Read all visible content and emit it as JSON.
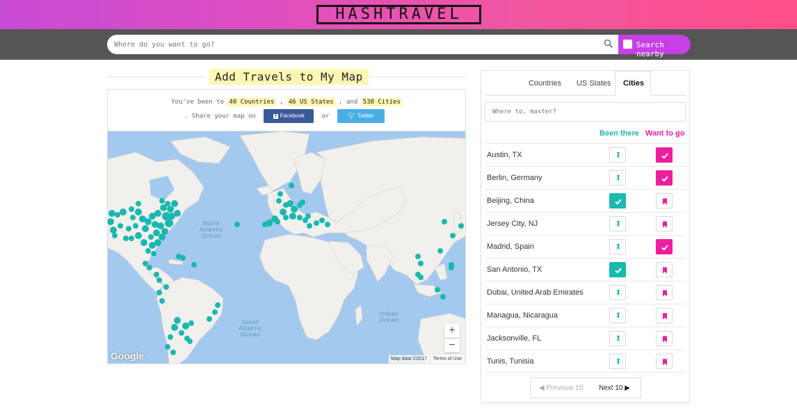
{
  "header": {
    "logo_text": "HASHTRAVEL",
    "gradient_colors": [
      "#c84bd6",
      "#ff4f8a"
    ]
  },
  "search": {
    "placeholder": "Where do you want to go?",
    "search_icon": "magnifier-icon",
    "nearby_label": "Search nearby",
    "nearby_checked": false
  },
  "left": {
    "title": "Add Travels to My Map",
    "stats": {
      "prefix": "You've been to",
      "countries": "40 Countries",
      "sep1": ",",
      "states": "46 US States",
      "sep2": ", and",
      "cities": "538 Cities",
      "share_prefix": ". Share your map on",
      "facebook": "Facebook",
      "or": "or",
      "twitter": "Twitter"
    },
    "map": {
      "ocean_north_atlantic": "North\nAtlantic\nOcean",
      "ocean_south_atlantic": "South\nAtlantic\nOcean",
      "ocean_indian": "Indian\nOcean",
      "zoom_in": "+",
      "zoom_out": "−",
      "google": "Google",
      "map_data": "Map data ©2017",
      "terms": "Terms of Use",
      "pin_color": "#19b8b0"
    }
  },
  "panel": {
    "tabs": [
      {
        "label": "Countries",
        "active": false
      },
      {
        "label": "US States",
        "active": false
      },
      {
        "label": "Cities",
        "active": true
      }
    ],
    "where_placeholder": "Where to, master?",
    "col_been": "Been there",
    "col_want": "Want to go",
    "colors": {
      "been": "#19b8b0",
      "want": "#ee1e9d"
    },
    "rows": [
      {
        "city": "Austin, TX",
        "been": false,
        "want": true
      },
      {
        "city": "Berlin, Germany",
        "been": false,
        "want": true
      },
      {
        "city": "Beijing, China",
        "been": true,
        "want": false
      },
      {
        "city": "Jersey City, NJ",
        "been": false,
        "want": false
      },
      {
        "city": "Madrid, Spain",
        "been": false,
        "want": true
      },
      {
        "city": "San Antonio, TX",
        "been": true,
        "want": false
      },
      {
        "city": "Dubai, United Arab Emirates",
        "been": false,
        "want": false
      },
      {
        "city": "Managua, Nicaragua",
        "been": false,
        "want": false
      },
      {
        "city": "Jacksonville, FL",
        "been": false,
        "want": false
      },
      {
        "city": "Tunis, Tunisia",
        "been": false,
        "want": false
      }
    ],
    "pager": {
      "prev": "Previous 10",
      "next": "Next 10"
    }
  }
}
